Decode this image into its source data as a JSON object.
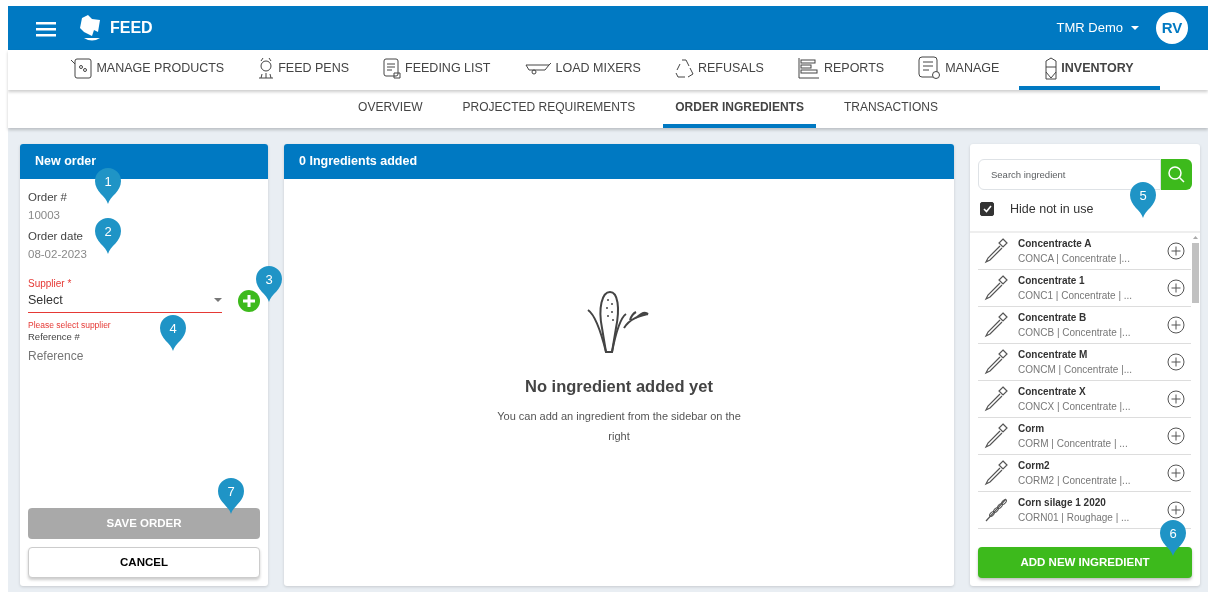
{
  "app": {
    "title": "FEED",
    "account": "TMR Demo",
    "avatar": "RV"
  },
  "main_tabs": [
    {
      "label": "MANAGE PRODUCTS",
      "selected": false
    },
    {
      "label": "FEED PENS",
      "selected": false
    },
    {
      "label": "FEEDING LIST",
      "selected": false
    },
    {
      "label": "LOAD MIXERS",
      "selected": false
    },
    {
      "label": "REFUSALS",
      "selected": false
    },
    {
      "label": "REPORTS",
      "selected": false
    },
    {
      "label": "MANAGE",
      "selected": false
    },
    {
      "label": "INVENTORY",
      "selected": true
    }
  ],
  "sub_tabs": [
    {
      "label": "OVERVIEW",
      "selected": false
    },
    {
      "label": "PROJECTED REQUIREMENTS",
      "selected": false
    },
    {
      "label": "ORDER INGREDIENTS",
      "selected": true
    },
    {
      "label": "TRANSACTIONS",
      "selected": false
    }
  ],
  "order_panel": {
    "title": "New order",
    "order_label": "Order #",
    "order_value": "10003",
    "date_label": "Order date",
    "date_value": "08-02-2023",
    "supplier": {
      "label": "Supplier",
      "required_mark": "*",
      "value": "Select",
      "invalid": true,
      "error": "Please select supplier"
    },
    "reference": {
      "label": "Reference #",
      "placeholder": "Reference"
    },
    "save_button": {
      "label": "SAVE ORDER",
      "disabled": true
    },
    "cancel_button": {
      "label": "CANCEL"
    }
  },
  "ingredients_panel": {
    "title": "0 Ingredients added",
    "empty_title": "No ingredient added yet",
    "empty_text": "You can add an ingredient from the sidebar on the right"
  },
  "sidebar": {
    "search": {
      "placeholder": "Search ingredient"
    },
    "hide_not_in_use": {
      "label": "Hide not in use",
      "checked": true
    },
    "items": [
      {
        "kind": "dropper",
        "name": "Concentracte A",
        "detail": "CONCA | Concentrate |..."
      },
      {
        "kind": "dropper",
        "name": "Concentrate 1",
        "detail": "CONC1 | Concentrate | ..."
      },
      {
        "kind": "dropper",
        "name": "Concentrate B",
        "detail": "CONCB | Concentrate |..."
      },
      {
        "kind": "dropper",
        "name": "Concentrate M",
        "detail": "CONCM | Concentrate |..."
      },
      {
        "kind": "dropper",
        "name": "Concentrate X",
        "detail": "CONCX | Concentrate |..."
      },
      {
        "kind": "dropper",
        "name": "Corm",
        "detail": "CORM | Concentrate | ..."
      },
      {
        "kind": "dropper",
        "name": "Corm2",
        "detail": "CORM2 | Concentrate |..."
      },
      {
        "kind": "grain",
        "name": "Corn silage 1 2020",
        "detail": "CORN01 | Roughage | ..."
      }
    ],
    "add_button": {
      "label": "ADD NEW INGREDIENT"
    }
  },
  "callouts": [
    {
      "label": "1"
    },
    {
      "label": "2"
    },
    {
      "label": "3"
    },
    {
      "label": "4"
    },
    {
      "label": "5"
    },
    {
      "label": "6"
    },
    {
      "label": "7"
    }
  ]
}
